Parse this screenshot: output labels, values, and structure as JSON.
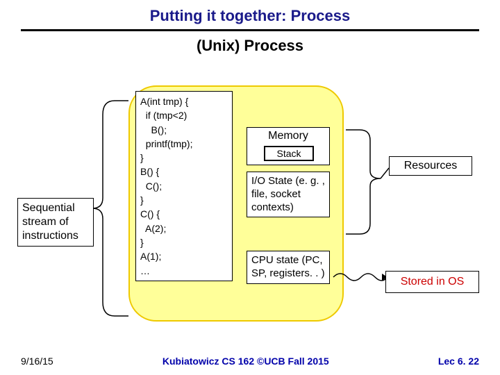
{
  "title": "Putting it together: Process",
  "subtitle": "(Unix) Process",
  "code": {
    "l1": "A(int tmp) {",
    "l2": "  if (tmp<2)",
    "l3": "    B();",
    "l4": "  printf(tmp);",
    "l5": "}",
    "l6": "B() {",
    "l7": "  C();",
    "l8": "}",
    "l9": "C() {",
    "l10": "  A(2);",
    "l11": "}",
    "l12": "A(1);",
    "l13": "…"
  },
  "memory_label": "Memory",
  "stack_label": "Stack",
  "io_text": "I/O State (e. g. , file, socket contexts)",
  "cpu_text": "CPU state (PC, SP, registers. . )",
  "seq_label": "Sequential stream of instructions",
  "resources_label": "Resources",
  "stored_label": "Stored in OS",
  "footer": {
    "left": "9/16/15",
    "center": "Kubiatowicz CS 162 ©UCB Fall 2015",
    "right": "Lec 6. 22"
  }
}
